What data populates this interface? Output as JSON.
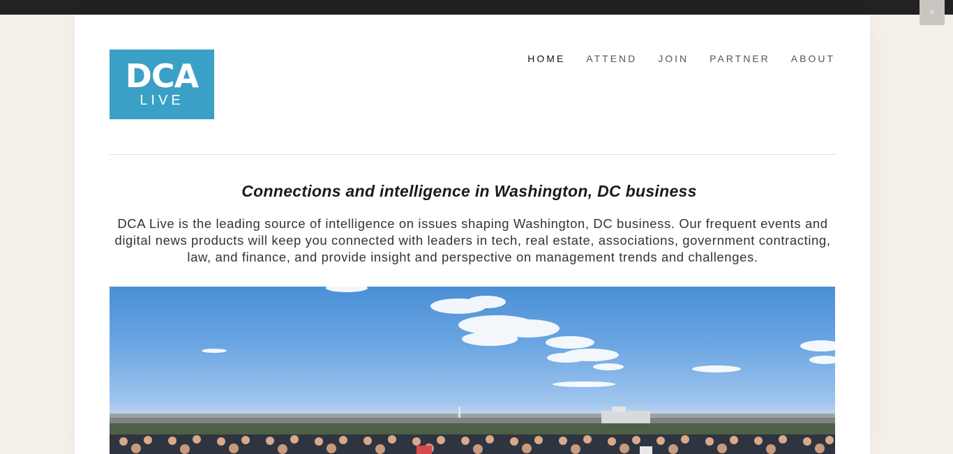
{
  "close_button": {
    "label": "×"
  },
  "logo": {
    "main": "DCA",
    "sub": "LIVE"
  },
  "nav": {
    "items": [
      {
        "label": "HOME",
        "active": true
      },
      {
        "label": "ATTEND",
        "active": false
      },
      {
        "label": "JOIN",
        "active": false
      },
      {
        "label": "PARTNER",
        "active": false
      },
      {
        "label": "ABOUT",
        "active": false
      }
    ]
  },
  "hero_text": {
    "headline": "Connections and intelligence in Washington, DC business",
    "intro": "DCA Live is the leading source of intelligence on issues shaping Washington, DC business. Our frequent events and digital news products will keep you connected with leaders in tech, real estate, associations, government contracting, law, and finance, and provide insight and perspective on management trends and challenges."
  },
  "colors": {
    "logo_bg": "#3aa0c5",
    "page_bg": "#f4efe8",
    "topbar": "#222222"
  }
}
